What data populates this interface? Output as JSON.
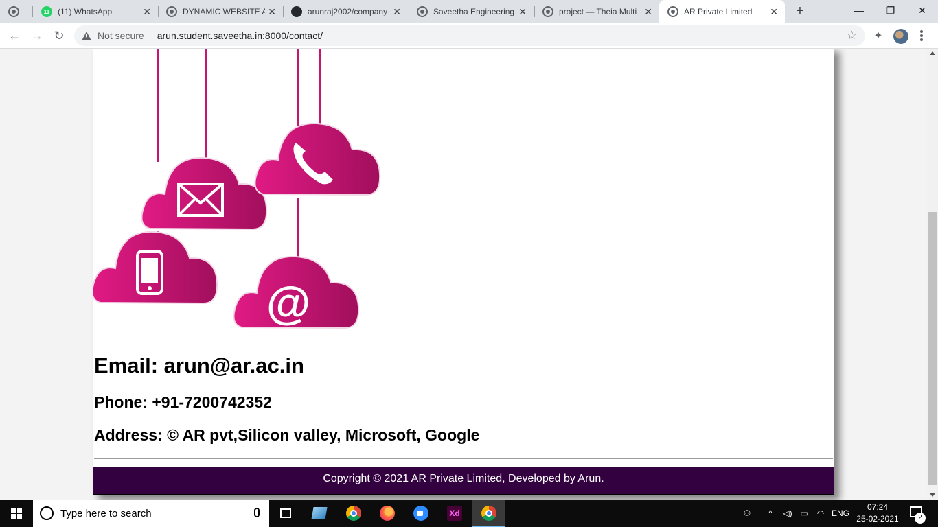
{
  "browser": {
    "tabs": [
      {
        "title": "(11) WhatsApp",
        "badge": "11",
        "icon": "whatsapp-icon"
      },
      {
        "title": "DYNAMIC WEBSITE AR",
        "icon": "globe-icon"
      },
      {
        "title": "arunraj2002/company",
        "icon": "github-icon"
      },
      {
        "title": "Saveetha Engineering",
        "icon": "globe-icon"
      },
      {
        "title": "project — Theia Multi",
        "icon": "globe-icon"
      },
      {
        "title": "AR Private Limited",
        "icon": "globe-icon",
        "active": true
      }
    ],
    "new_tab": "+",
    "window_controls": {
      "minimize": "—",
      "restore": "❐",
      "close": "✕"
    },
    "nav": {
      "back": "←",
      "forward": "→",
      "reload": "↻"
    },
    "security_label": "Not secure",
    "url": "arun.student.saveetha.in:8000/contact/",
    "star": "☆",
    "extensions": "✦"
  },
  "page": {
    "illustration_alt": "contact clouds",
    "email": "Email: arun@ar.ac.in",
    "phone": "Phone: +91-7200742352",
    "address": "Address: © AR pvt,Silicon valley, Microsoft, Google",
    "footer": "Copyright © 2021 AR Private Limited, Developed by Arun.",
    "colors": {
      "cloud": "#d6197a",
      "cloud_dark": "#a10f5c",
      "footer_bg": "#330140"
    }
  },
  "taskbar": {
    "search_placeholder": "Type here to search",
    "apps": [
      "task-view",
      "windows-journal",
      "chrome",
      "firefox",
      "zoom",
      "adobe-xd",
      "chrome-active"
    ],
    "xd_label": "Xd",
    "language": "ENG",
    "time": "07:24",
    "date": "25-02-2021",
    "notification_count": "2"
  }
}
